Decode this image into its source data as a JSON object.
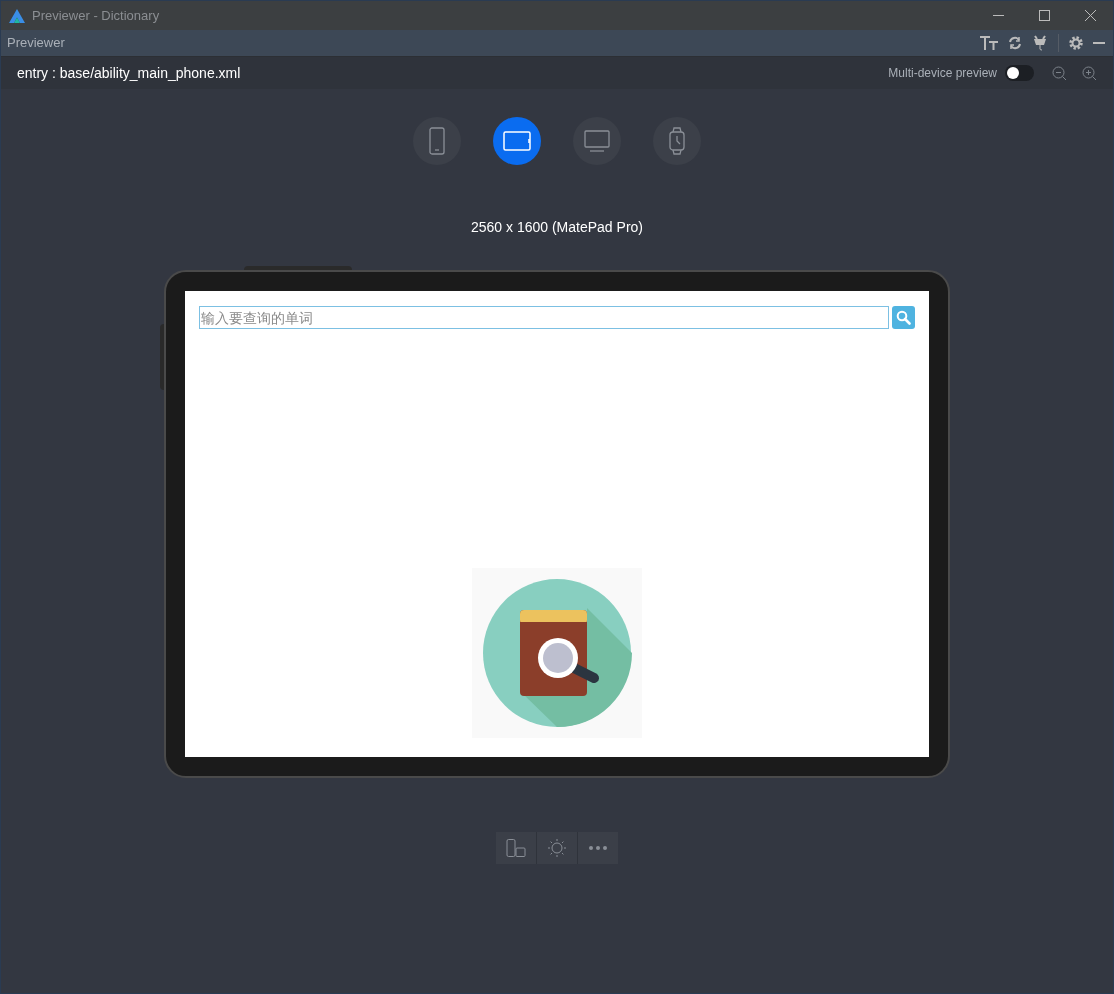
{
  "window": {
    "title": "Previewer - Dictionary"
  },
  "panel": {
    "title": "Previewer"
  },
  "toolbar": {
    "path": "entry : base/ability_main_phone.xml",
    "multi_device": {
      "label": "Multi-device preview",
      "on": false
    }
  },
  "devices": [
    {
      "kind": "phone",
      "selected": false
    },
    {
      "kind": "tablet",
      "selected": true
    },
    {
      "kind": "tv",
      "selected": false
    },
    {
      "kind": "watch",
      "selected": false
    }
  ],
  "resolution": "2560 x 1600 (MatePad Pro)",
  "app": {
    "search": {
      "placeholder": "输入要查询的单词"
    }
  }
}
